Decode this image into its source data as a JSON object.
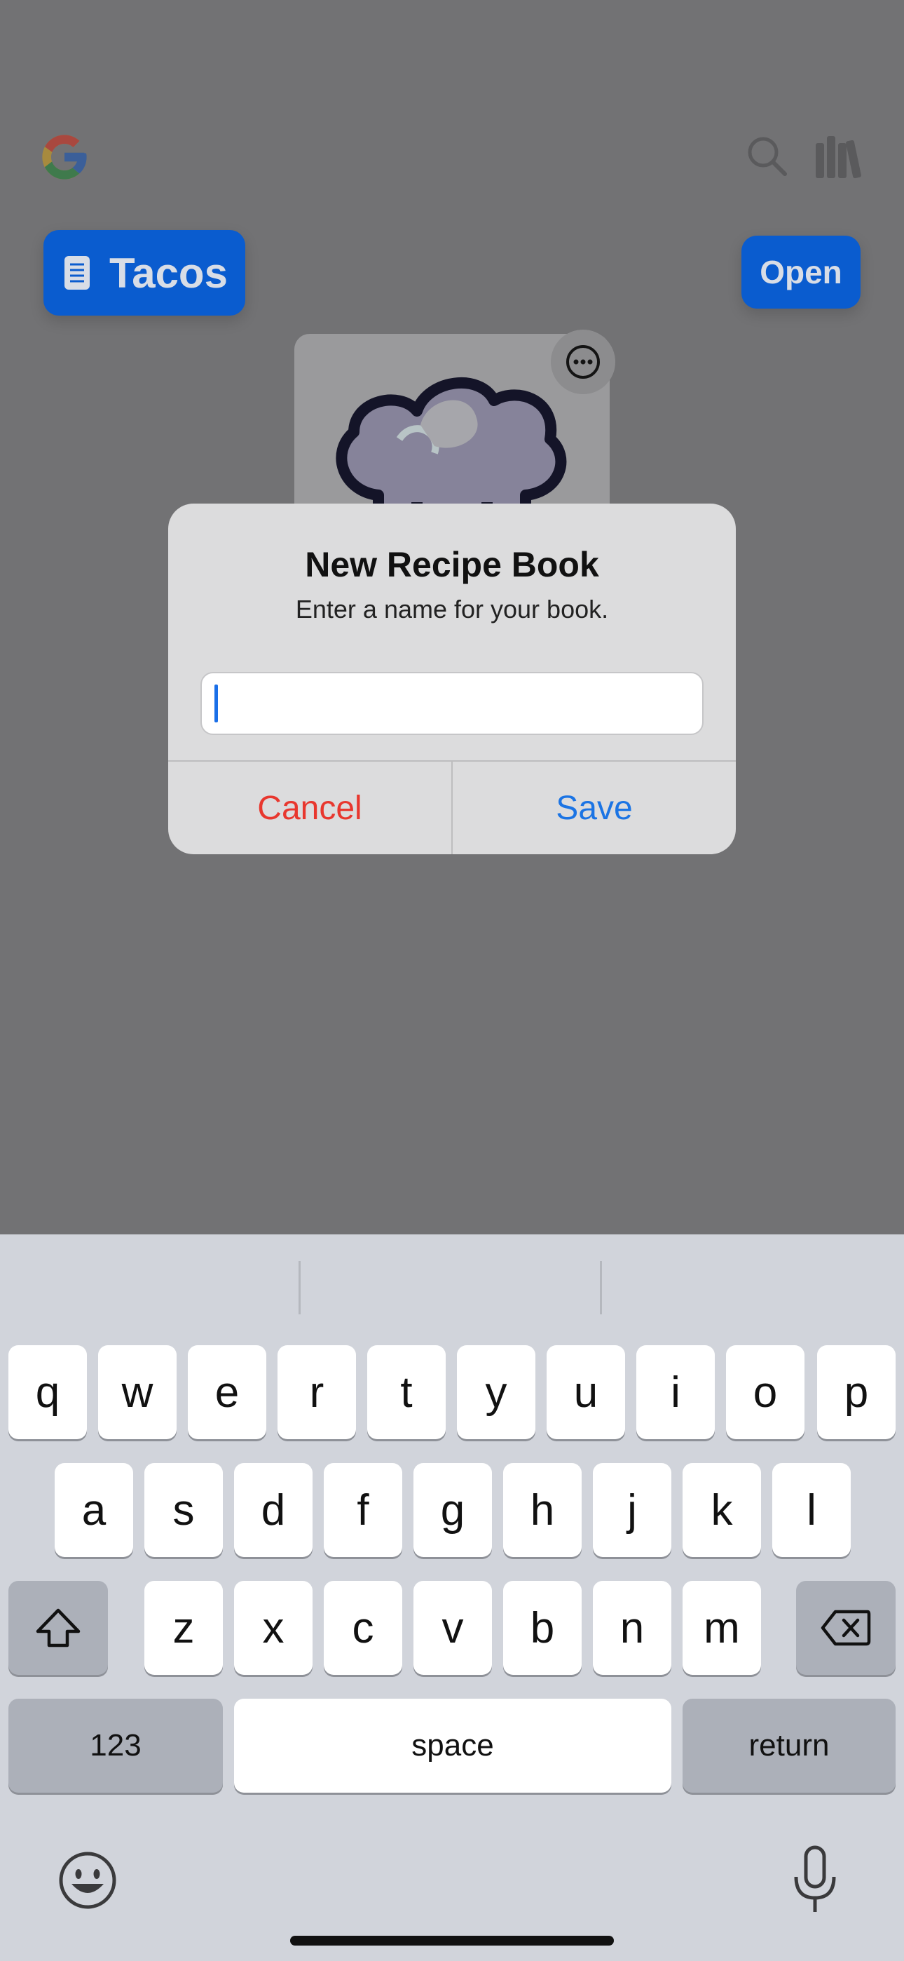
{
  "app": {
    "tacos_label": "Tacos",
    "open_label": "Open"
  },
  "dialog": {
    "title": "New Recipe Book",
    "message": "Enter a name for your book.",
    "input_value": "",
    "cancel_label": "Cancel",
    "save_label": "Save"
  },
  "keyboard": {
    "row1": [
      "q",
      "w",
      "e",
      "r",
      "t",
      "y",
      "u",
      "i",
      "o",
      "p"
    ],
    "row2": [
      "a",
      "s",
      "d",
      "f",
      "g",
      "h",
      "j",
      "k",
      "l"
    ],
    "row3": [
      "z",
      "x",
      "c",
      "v",
      "b",
      "n",
      "m"
    ],
    "numbers_label": "123",
    "space_label": "space",
    "return_label": "return"
  },
  "colors": {
    "accent_blue": "#1b74e4",
    "destructive_red": "#e8372e",
    "button_blue": "#0a5ccf"
  }
}
